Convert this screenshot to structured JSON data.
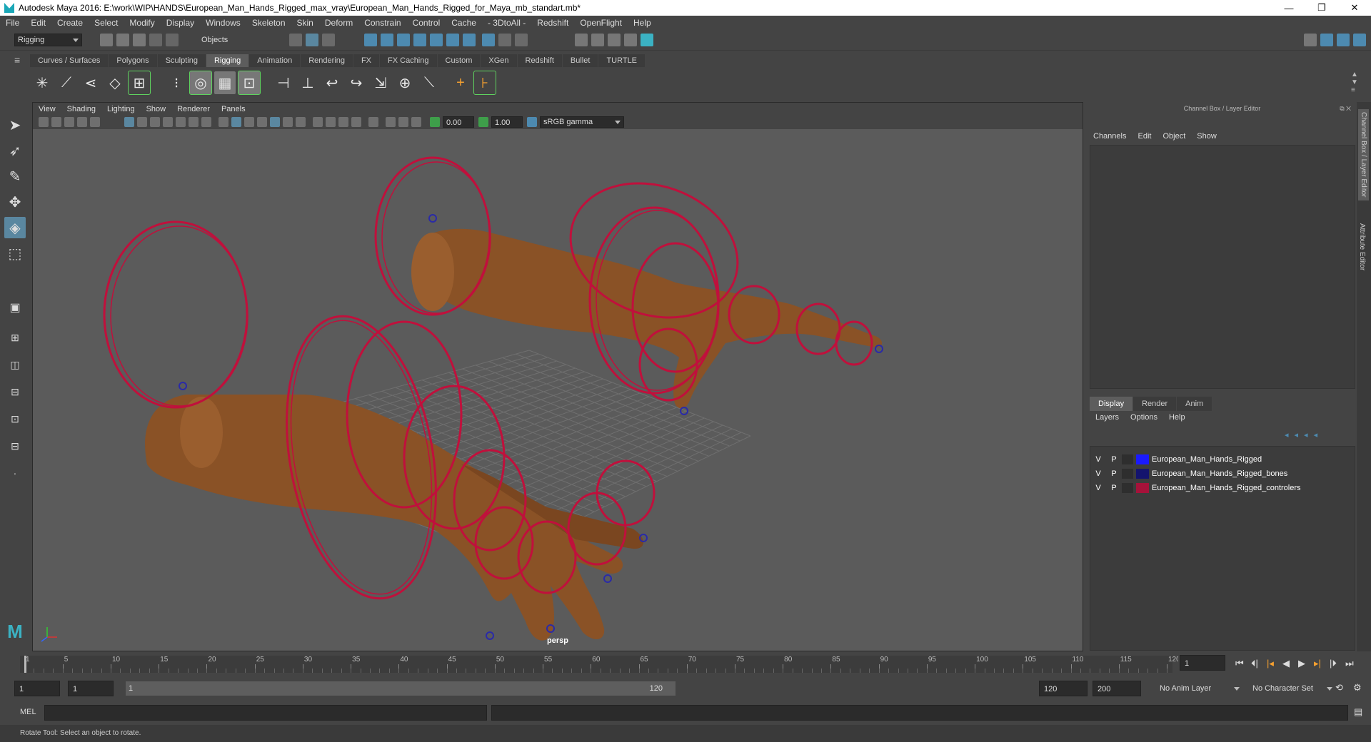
{
  "window": {
    "title": "Autodesk Maya 2016: E:\\work\\WIP\\HANDS\\European_Man_Hands_Rigged_max_vray\\European_Man_Hands_Rigged_for_Maya_mb_standart.mb*",
    "minimize": "—",
    "maximize": "❐",
    "close": "✕"
  },
  "menu": [
    "File",
    "Edit",
    "Create",
    "Select",
    "Modify",
    "Display",
    "Windows",
    "Skeleton",
    "Skin",
    "Deform",
    "Constrain",
    "Control",
    "Cache",
    "- 3DtoAll -",
    "Redshift",
    "OpenFlight",
    "Help"
  ],
  "toolbar": {
    "menuset": "Rigging",
    "select_mode": "Objects"
  },
  "shelf_tabs": [
    "Curves / Surfaces",
    "Polygons",
    "Sculpting",
    "Rigging",
    "Animation",
    "Rendering",
    "FX",
    "FX Caching",
    "Custom",
    "XGen",
    "Redshift",
    "Bullet",
    "TURTLE"
  ],
  "active_shelf_tab": "Rigging",
  "viewport": {
    "menu": [
      "View",
      "Shading",
      "Lighting",
      "Show",
      "Renderer",
      "Panels"
    ],
    "near_value": "0.00",
    "far_value": "1.00",
    "color_space": "sRGB gamma",
    "camera_label": "persp"
  },
  "channel_box": {
    "header": "Channel Box / Layer Editor",
    "menu": [
      "Channels",
      "Edit",
      "Object",
      "Show"
    ]
  },
  "layer_editor": {
    "tabs": [
      "Display",
      "Render",
      "Anim"
    ],
    "active_tab": "Display",
    "menu": [
      "Layers",
      "Options",
      "Help"
    ],
    "layers": [
      {
        "v": "V",
        "p": "P",
        "name": "European_Man_Hands_Rigged",
        "color": "#1a1aff"
      },
      {
        "v": "V",
        "p": "P",
        "name": "European_Man_Hands_Rigged_bones",
        "color": "#14146e"
      },
      {
        "v": "V",
        "p": "P",
        "name": "European_Man_Hands_Rigged_controlers",
        "color": "#a5123a"
      }
    ]
  },
  "side_tabs": [
    "Channel Box / Layer Editor",
    "Attribute Editor"
  ],
  "timeline": {
    "ticks": [
      "1",
      "5",
      "10",
      "15",
      "20",
      "25",
      "30",
      "35",
      "40",
      "45",
      "50",
      "55",
      "60",
      "65",
      "70",
      "75",
      "80",
      "85",
      "90",
      "95",
      "100",
      "105",
      "110",
      "115",
      "120"
    ],
    "current_frame": "1"
  },
  "range": {
    "start": "1",
    "anim_start": "1",
    "slider_start": "1",
    "slider_end": "120",
    "end": "120",
    "anim_end": "200",
    "anim_layer": "No Anim Layer",
    "character_set": "No Character Set"
  },
  "mel": {
    "label": "MEL"
  },
  "help_line": "Rotate Tool: Select an object to rotate.",
  "colors": {
    "controller": "#c0103c",
    "skin": "#8a5226",
    "accent": "#5a87a0",
    "viewport_bg": "#5b5b5b"
  }
}
